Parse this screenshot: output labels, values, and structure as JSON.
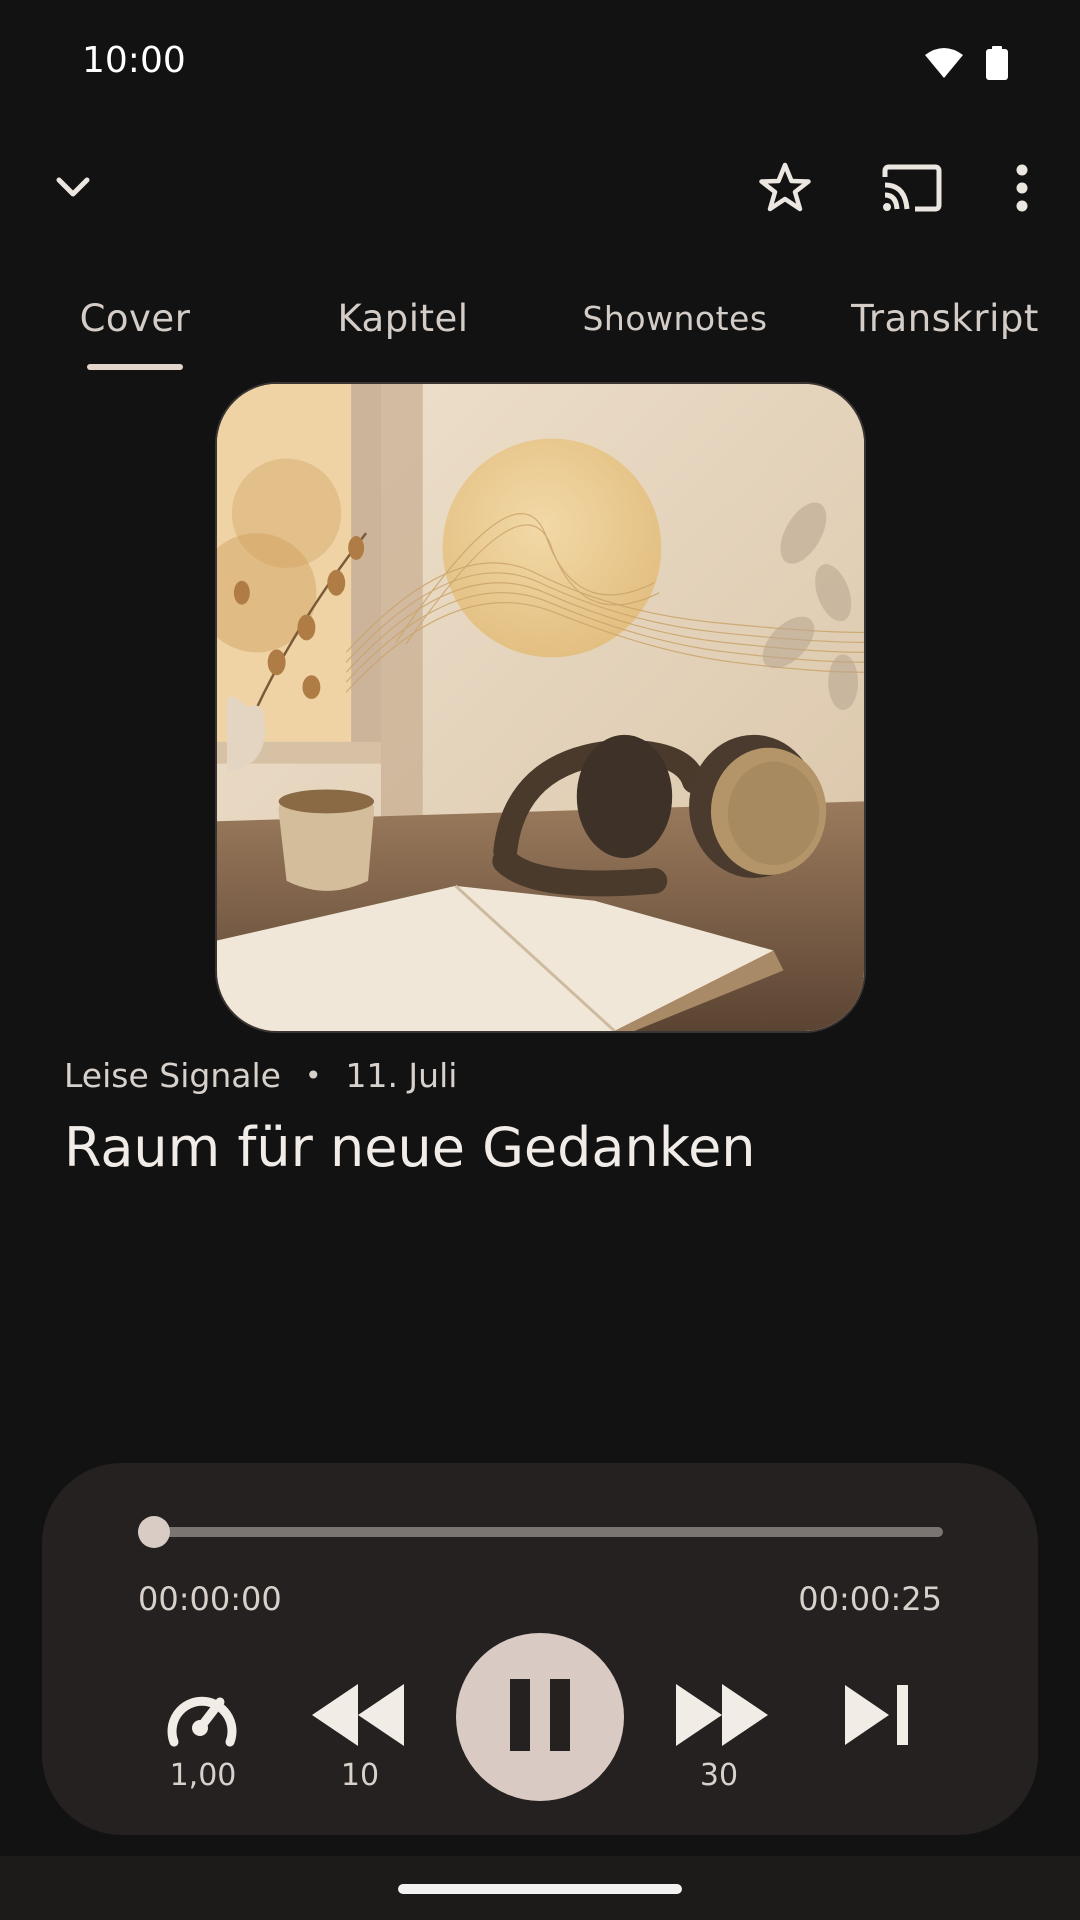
{
  "status_bar": {
    "time": "10:00",
    "icons": [
      "wifi-icon",
      "battery-icon"
    ]
  },
  "top_bar": {
    "icons": [
      "chevron-down-icon",
      "star-outline-icon",
      "cast-icon",
      "more-vert-icon"
    ]
  },
  "tabs": [
    {
      "label": "Cover",
      "selected": true
    },
    {
      "label": "Kapitel",
      "selected": false
    },
    {
      "label": "Shownotes",
      "selected": false
    },
    {
      "label": "Transkript",
      "selected": false
    }
  ],
  "episode": {
    "podcast": "Leise Signale",
    "separator": "•",
    "date": "11. Juli",
    "title": "Raum für neue Gedanken"
  },
  "player": {
    "elapsed": "00:00:00",
    "remaining": "00:00:25",
    "progress_fraction": 0.0,
    "speed_label": "1,00",
    "rewind_label": "10",
    "forward_label": "30",
    "state": "playing"
  },
  "colors": {
    "background": "#121212",
    "player_surface": "#252120",
    "accent": "#d9cbc4"
  }
}
